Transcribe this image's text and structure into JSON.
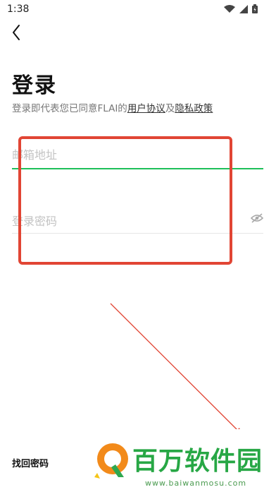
{
  "status": {
    "time": "1:38"
  },
  "login": {
    "title": "登录",
    "agreement_prefix": "登录即代表您已同意FLAI的",
    "user_agreement": "用户协议",
    "and": "及",
    "privacy_policy": "隐私政策",
    "email_placeholder": "邮箱地址",
    "password_placeholder": "登录密码",
    "forgot_password": "找回密码"
  },
  "watermark": {
    "name": "百万软件园",
    "url": "www.baiwanmosu.com"
  },
  "colors": {
    "accent": "#1ec05a",
    "annotation": "#e14534"
  }
}
